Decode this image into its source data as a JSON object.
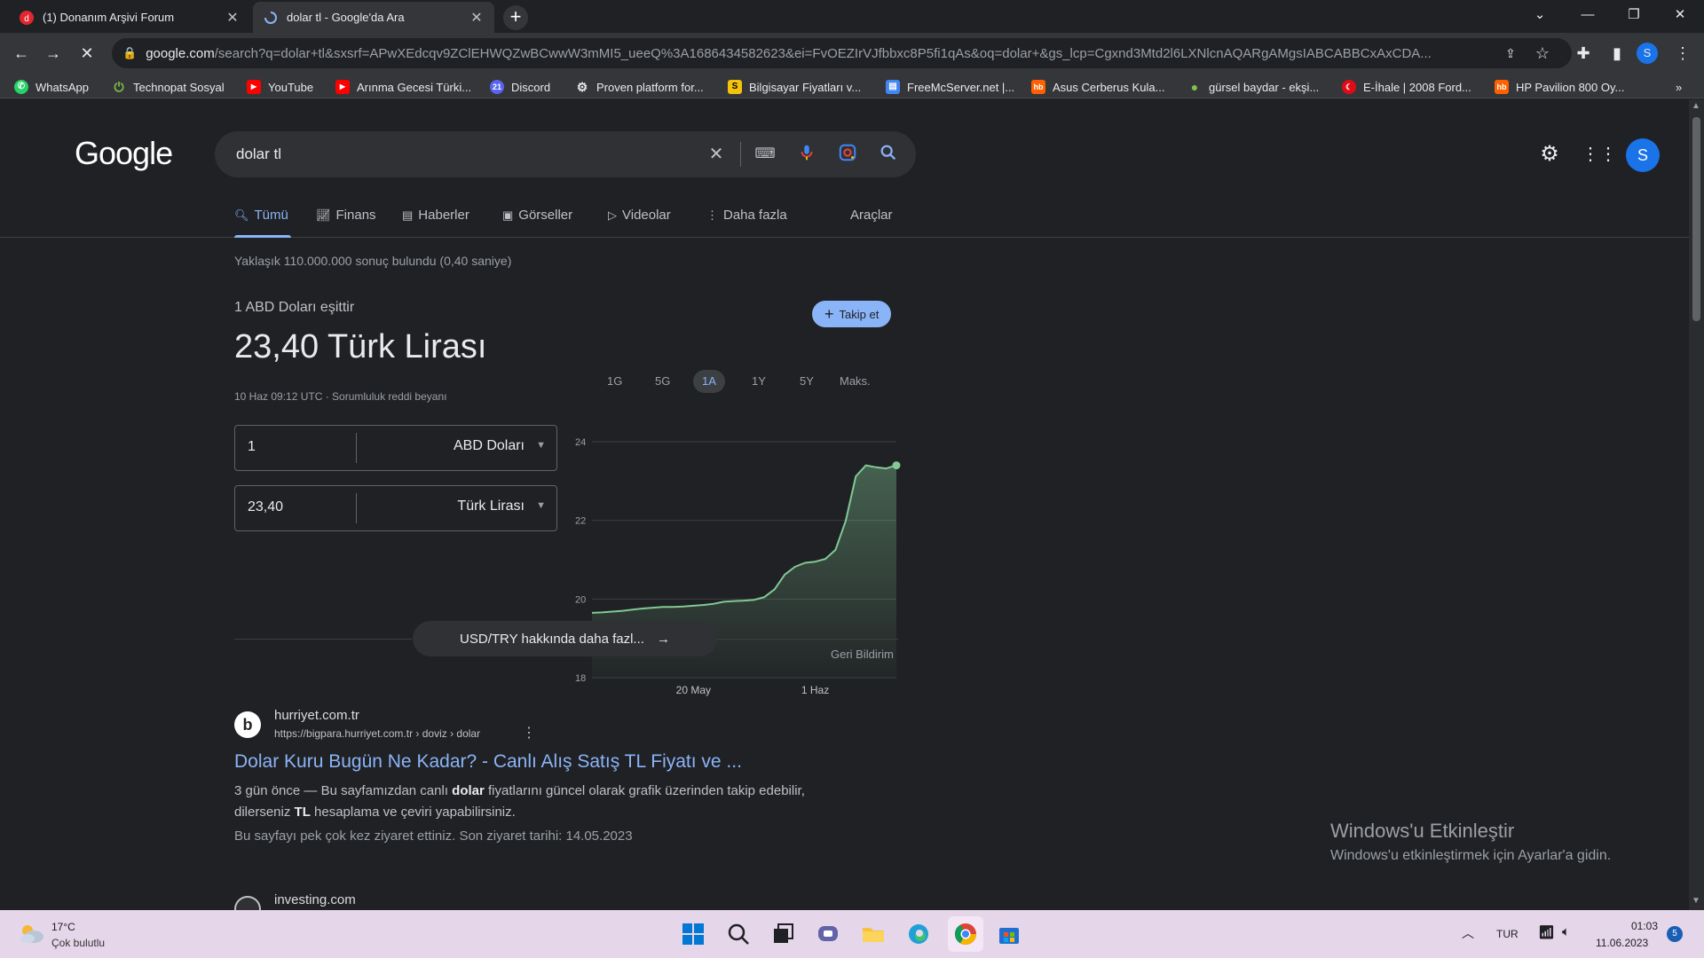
{
  "browser": {
    "tabs": [
      {
        "title": "(1) Donanım Arşivi Forum"
      },
      {
        "title": "dolar tl - Google'da Ara"
      }
    ],
    "url_host": "google.com",
    "url_rest": "/search?q=dolar+tl&sxsrf=APwXEdcqv9ZClEHWQZwBCwwW3mMI5_ueeQ%3A1686434582623&ei=FvOEZIrVJfbbxc8P5fi1qAs&oq=dolar+&gs_lcp=Cgxnd3Mtd2l6LXNlcnAQARgAMgsIABCABBCxAxCDA...",
    "profile_initial": "S",
    "bookmarks": [
      {
        "label": "WhatsApp",
        "icon": "whatsapp-icon",
        "color": "#25d366"
      },
      {
        "label": "Technopat Sosyal",
        "icon": "power-icon",
        "color": "#7ac142"
      },
      {
        "label": "YouTube",
        "icon": "youtube-icon",
        "color": "#ff0000"
      },
      {
        "label": "Arınma Gecesi Türki...",
        "icon": "youtube-icon",
        "color": "#ff0000"
      },
      {
        "label": "Discord",
        "icon": "discord-icon",
        "color": "#5865f2"
      },
      {
        "label": "Proven platform for...",
        "icon": "gear-icon",
        "color": "#9aa0a6"
      },
      {
        "label": "Bilgisayar Fiyatları v...",
        "icon": "s-icon",
        "color": "#f4c20d"
      },
      {
        "label": "FreeMcServer.net |...",
        "icon": "server-icon",
        "color": "#4285f4"
      },
      {
        "label": "Asus Cerberus Kula...",
        "icon": "hb-icon",
        "color": "#ff6000"
      },
      {
        "label": "gürsel baydar - ekşi...",
        "icon": "drop-icon",
        "color": "#81c14b"
      },
      {
        "label": "E-İhale | 2008 Ford...",
        "icon": "flag-icon",
        "color": "#e30a17"
      },
      {
        "label": "HP Pavilion 800 Oy...",
        "icon": "hb-icon",
        "color": "#ff6000"
      }
    ]
  },
  "google": {
    "logo": "Google",
    "query": "dolar tl",
    "nav": [
      {
        "label": "Tümü",
        "icon": "search-icon"
      },
      {
        "label": "Finans",
        "icon": "finance-icon"
      },
      {
        "label": "Haberler",
        "icon": "news-icon"
      },
      {
        "label": "Görseller",
        "icon": "image-icon"
      },
      {
        "label": "Videolar",
        "icon": "video-icon"
      },
      {
        "label": "Daha fazla",
        "icon": "more-icon"
      }
    ],
    "tools": "Araçlar",
    "result_stats": "Yaklaşık 110.000.000 sonuç bulundu (0,40 saniye)",
    "avatar_initial": "S"
  },
  "currency": {
    "equals_label": "1 ABD Doları eşittir",
    "rate": "23,40 Türk Lirası",
    "follow": "Takip et",
    "timestamp": "10 Haz 09:12 UTC · Sorumluluk reddi beyanı",
    "ranges": [
      "1G",
      "5G",
      "1A",
      "1Y",
      "5Y",
      "Maks."
    ],
    "active_range": "1A",
    "from": {
      "value": "1",
      "currency": "ABD Doları"
    },
    "to": {
      "value": "23,40",
      "currency": "Türk Lirası"
    },
    "more": "USD/TRY hakkında daha fazl...",
    "feedback": "Geri Bildirim"
  },
  "chart_data": {
    "type": "area",
    "y_ticks": [
      "24",
      "22",
      "20",
      "18"
    ],
    "x_ticks": [
      "20 May",
      "1 Haz"
    ],
    "ylim": [
      18,
      24
    ],
    "x": [
      0,
      1,
      2,
      3,
      4,
      5,
      6,
      7,
      8,
      9,
      10,
      11,
      12,
      13,
      14,
      15,
      16,
      17,
      18,
      19,
      20,
      21,
      22,
      23,
      24,
      25,
      26,
      27,
      28,
      29,
      30
    ],
    "values": [
      19.65,
      19.66,
      19.68,
      19.7,
      19.73,
      19.76,
      19.78,
      19.8,
      19.8,
      19.81,
      19.83,
      19.85,
      19.88,
      19.93,
      19.95,
      19.96,
      19.98,
      20.05,
      20.25,
      20.62,
      20.82,
      20.92,
      20.95,
      21.02,
      21.25,
      21.98,
      23.12,
      23.4,
      23.35,
      23.32,
      23.4
    ],
    "x_tick_positions": [
      10,
      22
    ],
    "color": "#81c995"
  },
  "result1": {
    "site": "hurriyet.com.tr",
    "url": "https://bigpara.hurriyet.com.tr › doviz › dolar",
    "title": "Dolar Kuru Bugün Ne Kadar? - Canlı Alış Satış TL Fiyatı ve ...",
    "snippet1_a": "3 gün önce — ",
    "snippet1_b": "Bu sayfamızdan canlı ",
    "snippet1_bold": "dolar",
    "snippet1_c": " fiyatlarını güncel olarak grafik üzerinden takip edebilir,",
    "snippet2_a": "dilerseniz ",
    "snippet2_bold": "TL",
    "snippet2_b": " hesaplama ve çeviri yapabilirsiniz.",
    "visited": "Bu sayfayı pek çok kez ziyaret ettiniz. Son ziyaret tarihi: 14.05.2023",
    "fav_letter": "b"
  },
  "result2": {
    "site": "investing.com"
  },
  "watermark": {
    "title": "Windows'u Etkinleştir",
    "subtitle": "Windows'u etkinleştirmek için Ayarlar'a gidin."
  },
  "taskbar": {
    "temp": "17°C",
    "condition": "Çok bulutlu",
    "lang": "TUR",
    "time": "01:03",
    "date": "11.06.2023",
    "notifications": "5"
  }
}
